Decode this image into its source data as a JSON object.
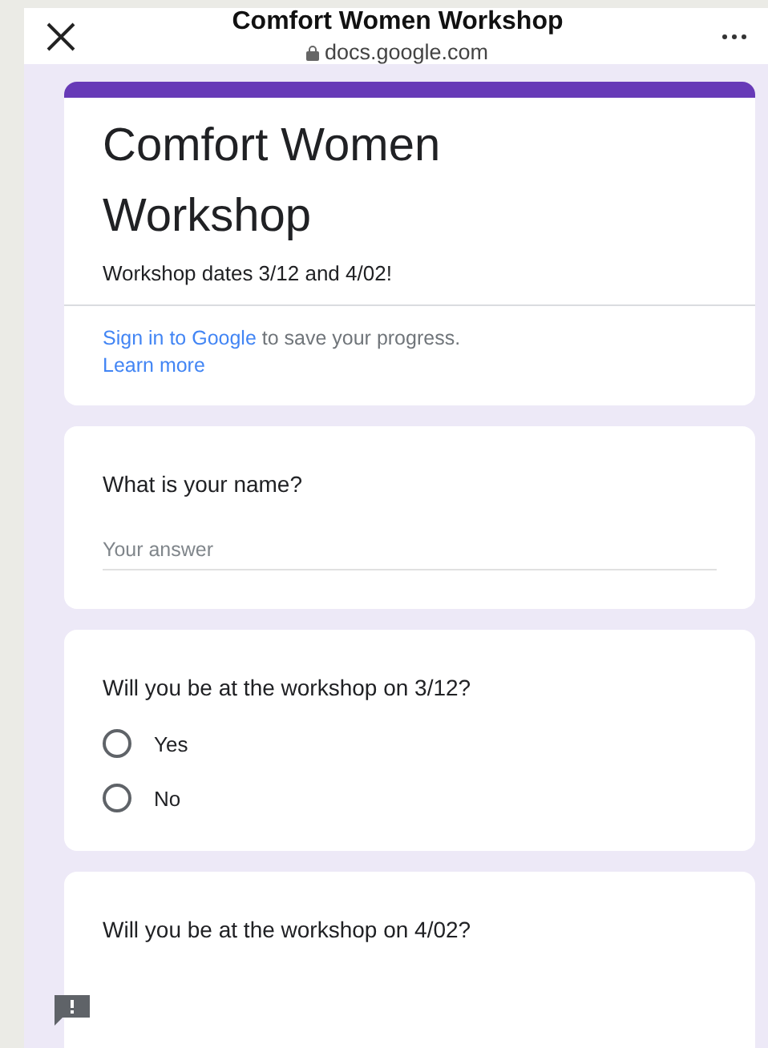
{
  "browser_bar": {
    "title": "Comfort Women Workshop",
    "domain": "docs.google.com"
  },
  "form_header": {
    "title": "Comfort Women Workshop",
    "description": "Workshop dates 3/12 and 4/02!",
    "sign_in_link": "Sign in to Google",
    "sign_in_text": " to save your progress.",
    "learn_more": "Learn more"
  },
  "questions": [
    {
      "kind": "text",
      "question": "What is your name?",
      "placeholder": "Your answer"
    },
    {
      "kind": "radio",
      "question": "Will you be at the workshop on 3/12?",
      "options": [
        {
          "label": "Yes",
          "selected": false
        },
        {
          "label": "No",
          "selected": false
        }
      ]
    },
    {
      "kind": "radio",
      "question": "Will you be at the workshop on 4/02?"
    }
  ]
}
